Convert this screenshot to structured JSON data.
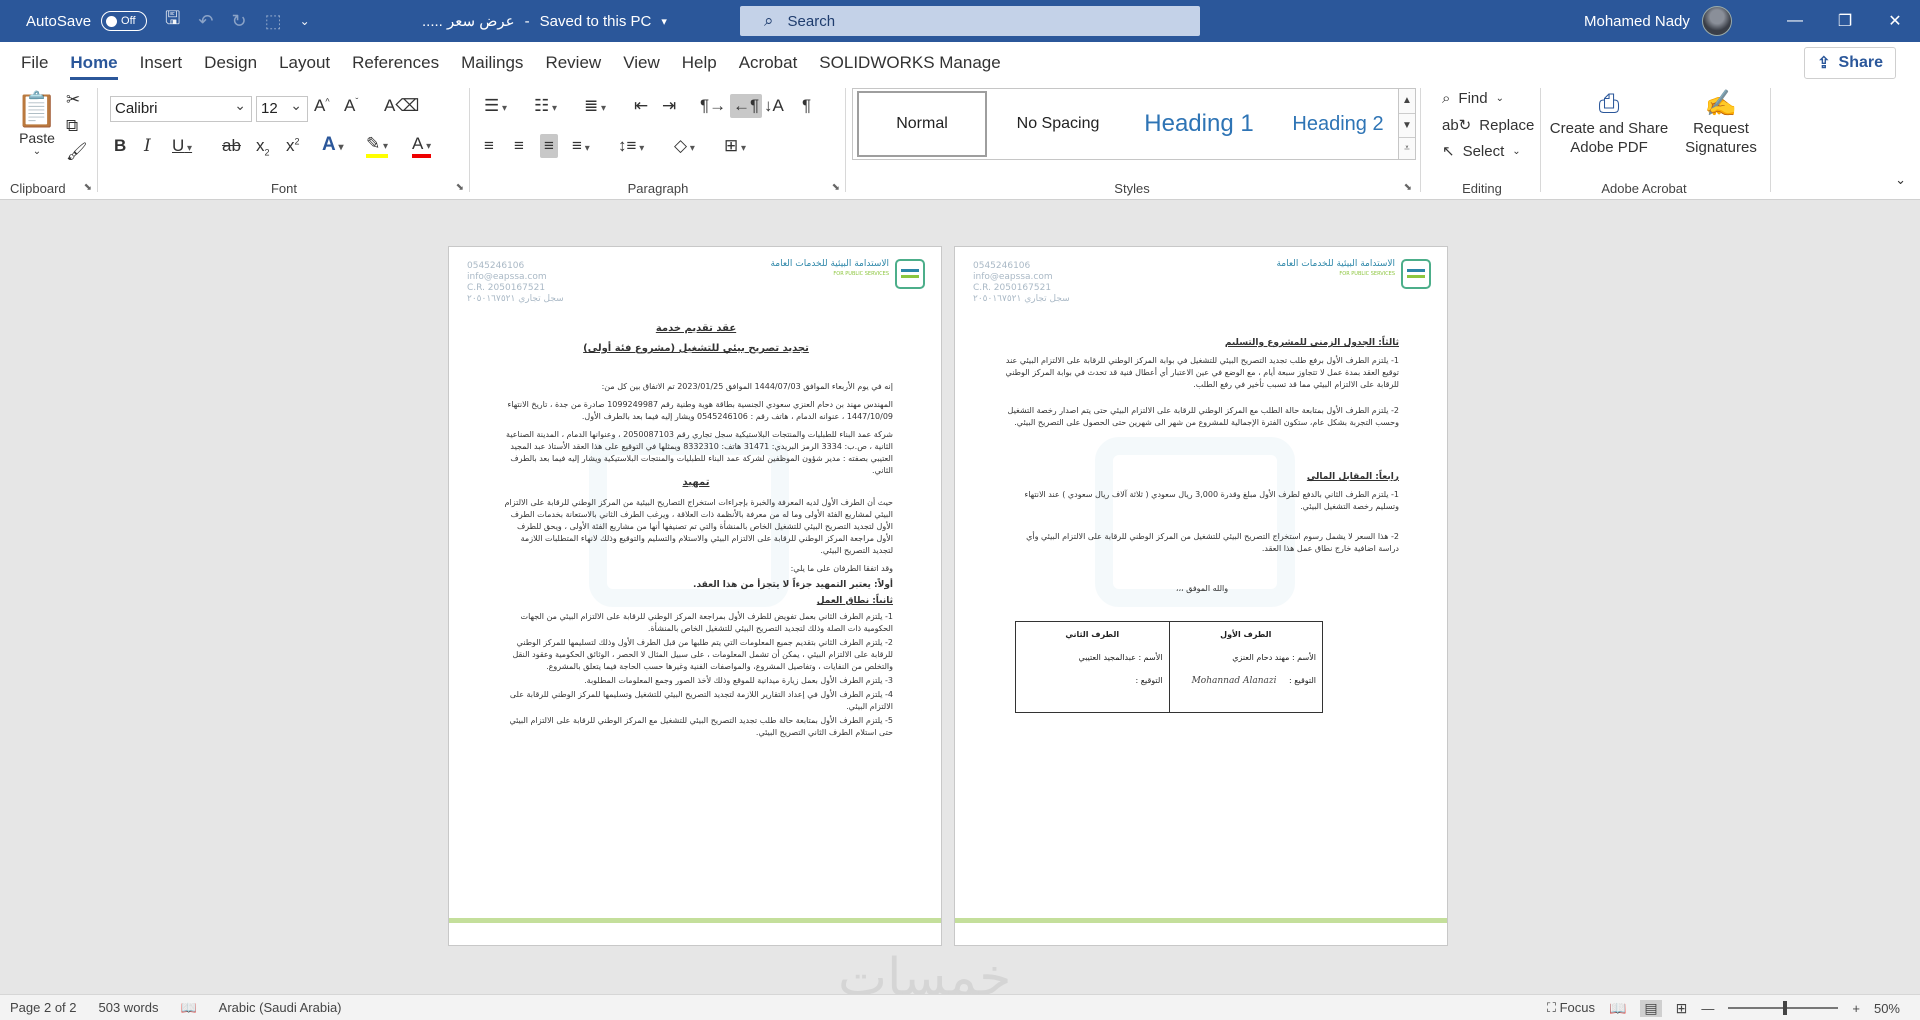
{
  "titlebar": {
    "autosave_label": "AutoSave",
    "autosave_state": "Off",
    "doc_name": "عرض سعر .....",
    "save_status": "Saved to this PC",
    "search_placeholder": "Search",
    "user_name": "Mohamed Nady"
  },
  "tabs": [
    "File",
    "Home",
    "Insert",
    "Design",
    "Layout",
    "References",
    "Mailings",
    "Review",
    "View",
    "Help",
    "Acrobat",
    "SOLIDWORKS Manage"
  ],
  "share_label": "Share",
  "ribbon": {
    "clipboard": {
      "paste": "Paste",
      "label": "Clipboard"
    },
    "font": {
      "name": "Calibri",
      "size": "12",
      "label": "Font"
    },
    "paragraph": {
      "label": "Paragraph"
    },
    "styles": {
      "normal": "Normal",
      "no_spacing": "No Spacing",
      "heading1": "Heading 1",
      "heading2": "Heading 2",
      "label": "Styles"
    },
    "editing": {
      "find": "Find",
      "replace": "Replace",
      "select": "Select",
      "label": "Editing"
    },
    "acrobat": {
      "create_share": "Create and Share",
      "adobe_pdf": "Adobe PDF",
      "request": "Request",
      "signatures": "Signatures",
      "label": "Adobe Acrobat"
    }
  },
  "header": {
    "phone": "0545246106",
    "email": "info@eapssa.com",
    "cr": "C.R. 2050167521",
    "cr_ar": "سجل تجاري ٢٠٥٠١٦٧٥٢١",
    "logo_ar": "الاستدامة البيئية للخدمات العامة",
    "logo_en": "FOR PUBLIC SERVICES"
  },
  "page1": {
    "title1": "عقد تقديم خدمة",
    "title2": "تجديد تصريح بيئي للتشغيل (مشروع فئة أولى)",
    "intro": "إنه في يوم الأربعاء الموافق 1444/07/03 الموافق 2023/01/25 تم الاتفاق بين كل من:",
    "party1": "المهندس مهند بن دحام العنزي سعودي الجنسية بطاقة هوية وطنية رقم 1099249987 صادرة من جدة ، تاريخ الانتهاء 1447/10/09 ، عنوانه الدمام ، هاتف رقم : 0545246106 ويشار إليه فيما بعد بالطرف الأول.",
    "party2": "شركة عمد البناء للطبليات والمنتجات البلاستيكية سجل تجاري رقم 2050087103 ، وعنوانها الدمام ، المدينة الصناعية الثانية ، ص.ب: 3334 الرمز البريدي: 31471 هاتف: 8332310 ويمثلها في التوقيع على هذا العقد الأستاذ عبد المجيد العتيبي بصفته : مدير شؤون الموظفين لشركة عمد البناء للطبليات والمنتجات البلاستيكية ويشار إليه فيما بعد بالطرف الثاني.",
    "preamble_title": "تمهيد",
    "preamble": "حيث أن الطرف الأول لديه المعرفة والخبرة بإجراءات استخراج التصاريح البيئية من المركز الوطني للرقابة على الالتزام البيئي لمشاريع الفئة الأولى وما له من معرفة بالأنظمة ذات العلاقة ، ويرغب الطرف الثاني بالاستعانة بخدمات الطرف الأول لتجديد التصريح البيئي للتشغيل الخاص بالمنشأة والتي تم تصنيفها أنها من مشاريع الفئة الأولى ، ويحق للطرف الأول مراجعة المركز الوطني للرقابة على الالتزام البيئي والاستلام والتسليم والتوقيع وذلك لانهاء المتطلبات اللازمة لتجديد التصريح البيئي.",
    "agreed": "وقد اتفقا الطرفان على ما يلي:",
    "first": "أولاً: يعتبر التمهيد جزءاً لا يتجزأ من هذا العقد.",
    "second_title": "ثانياً: نطاق العمل",
    "items": [
      "1- يلتزم الطرف الثاني بعمل تفويض للطرف الأول بمراجعة المركز الوطني للرقابة على الالتزام البيئي من الجهات الحكومية ذات الصلة وذلك لتجديد التصريح البيئي للتشغيل الخاص بالمنشأة.",
      "2- يلتزم الطرف الثاني بتقديم جميع المعلومات التي يتم طلبها من قبل الطرف الأول وذلك لتسليمها للمركز الوطني للرقابة على الالتزام البيئي ، يمكن أن تشمل المعلومات ، على سبيل المثال لا الحصر ، الوثائق الحكومية وعقود النقل والتخلص من النفايات ، وتفاصيل المشروع، والمواصفات الفنية وغيرها حسب الحاجة فيما يتعلق بالمشروع.",
      "3- يلتزم الطرف الأول بعمل زيارة ميدانية للموقع وذلك لأخذ الصور وجمع المعلومات المطلوبة.",
      "4- يلتزم الطرف الأول في إعداد التقارير اللازمة لتجديد التصريح البيئي للتشغيل وتسليمها للمركز الوطني للرقابة على الالتزام البيئي.",
      "5- يلتزم الطرف الأول بمتابعة حالة طلب تجديد التصريح البيئي للتشغيل مع المركز الوطني للرقابة على الالتزام البيئي حتى استلام الطرف الثاني التصريح البيئي."
    ]
  },
  "page2": {
    "third_title": "ثالثاً: الجدول الزمني للمشروع والتسليم",
    "third_items": [
      "1- يلتزم الطرف الأول برفع طلب تجديد التصريح البيئي للتشغيل في بوابة المركز الوطني للرقابة على الالتزام البيئي عند توقيع العقد بمدة عمل لا تتجاوز سبعة أيام ، مع الوضع في عين الاعتبار أي أعطال فنية قد تحدث في بوابة المركز الوطني للرقابة على الالتزام البيئي مما قد تسبب تأخير في رفع الطلب.",
      "2- يلتزم الطرف الأول بمتابعة حالة الطلب مع المركز الوطني للرقابة على الالتزام البيئي حتى يتم اصدار رخصة التشغيل وحسب التجربة بشكل عام، ستكون الفترة الإجمالية للمشروع من شهر الى شهرين حتى الحصول على التصريح البيئي."
    ],
    "fourth_title": "رابعاً: المقابل المالي",
    "fourth_items": [
      "1- يلتزم الطرف الثاني بالدفع لطرف الأول مبلغ وقدرة 3,000 ريال سعودي ( ثلاثة آلاف ريال سعودي ) عند الانتهاء وتسليم رخصة التشغيل البيئي.",
      "2- هذا السعر لا يشمل رسوم استخراج التصريح البيئي للتشغيل من المركز الوطني للرقابة على الالتزام البيئي وأي دراسة اضافية خارج نطاق عمل هذا العقد."
    ],
    "closing": "والله الموفق ،،،",
    "sig": {
      "first_party": "الطرف الأول",
      "second_party": "الطرف الثاني",
      "name_label": "الأسم :",
      "first_name": "مهند دحام العنزي",
      "second_name": "عبدالمجيد العتيبي",
      "sign_label": "التوقيع :",
      "handwritten": "Mohannad Alanazi"
    }
  },
  "watermark_text": "خمسات",
  "status": {
    "page": "Page 2 of 2",
    "words": "503 words",
    "language": "Arabic (Saudi Arabia)",
    "focus": "Focus",
    "zoom": "50%"
  }
}
